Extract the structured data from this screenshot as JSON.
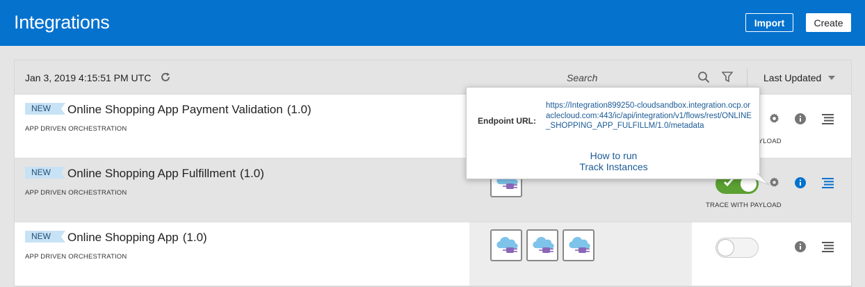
{
  "header": {
    "title": "Integrations",
    "import_label": "Import",
    "create_label": "Create"
  },
  "toolbar": {
    "timestamp": "Jan 3, 2019 4:15:51 PM UTC",
    "search_placeholder": "Search",
    "sort_label": "Last Updated"
  },
  "integrations": [
    {
      "badge": "NEW",
      "name": "Online Shopping App Payment Validation",
      "version": "(1.0)",
      "type": "APP DRIVEN ORCHESTRATION",
      "trace": "TRACE WITH PAYLOAD",
      "active": true
    },
    {
      "badge": "NEW",
      "name": "Online Shopping App Fulfillment",
      "version": "(1.0)",
      "type": "APP DRIVEN ORCHESTRATION",
      "trace": "TRACE WITH PAYLOAD",
      "active": true
    },
    {
      "badge": "NEW",
      "name": "Online Shopping App",
      "version": "(1.0)",
      "type": "APP DRIVEN ORCHESTRATION",
      "active": false
    }
  ],
  "popup": {
    "endpoint_label": "Endpoint URL:",
    "endpoint_url": "https://Integration899250-cloudsandbox.integration.ocp.oraclecloud.com:443/ic/api/integration/v1/flows/rest/ONLINE_SHOPPING_APP_FULFILLM/1.0/metadata",
    "how_to_run": "How to run",
    "track_instances": "Track Instances"
  },
  "colors": {
    "header_bg": "#0572ce",
    "active_toggle": "#5ba032",
    "link": "#1b5a96",
    "badge_bg": "#c8e2f5"
  }
}
